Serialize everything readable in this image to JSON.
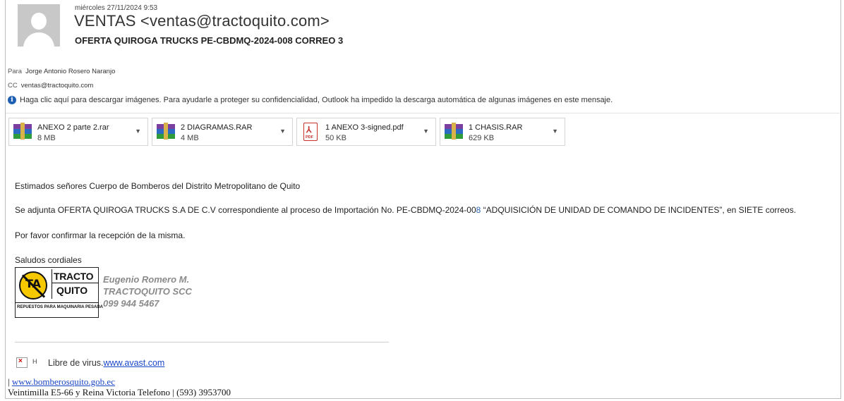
{
  "header": {
    "date": "miércoles 27/11/2024 9:53",
    "sender": "VENTAS <ventas@tractoquito.com>",
    "subject": "OFERTA QUIROGA TRUCKS PE-CBDMQ-2024-008 CORREO 3",
    "to_label": "Para",
    "to_value": "Jorge Antonio Rosero Naranjo",
    "cc_label": "CC",
    "cc_value": "ventas@tractoquito.com",
    "info_icon": "i",
    "info_text": "Haga clic aquí para descargar imágenes. Para ayudarle a proteger su confidencialidad, Outlook ha impedido la descarga automática de algunas imágenes en este mensaje."
  },
  "attachments": [
    {
      "name": "ANEXO 2 parte 2.rar",
      "size": "8 MB",
      "icon": "winrar-archive-icon"
    },
    {
      "name": "2 DIAGRAMAS.RAR",
      "size": "4 MB",
      "icon": "winrar-archive-icon"
    },
    {
      "name": "1 ANEXO 3-signed.pdf",
      "size": "50 KB",
      "icon": "pdf-file-icon"
    },
    {
      "name": "1 CHASIS.RAR",
      "size": "629 KB",
      "icon": "winrar-archive-icon"
    }
  ],
  "body": {
    "greeting": "Estimados señores Cuerpo de Bomberos del Distrito Metropolitano de Quito",
    "line2_a": "Se adjunta OFERTA QUIROGA TRUCKS S.A DE C.V correspondiente al proceso de Importación No.  PE-CBDMQ-2024-00",
    "line2_b": "8",
    "line2_c": "  “ADQUISICIÓN DE UNIDAD DE COMANDO DE INCIDENTES”, en SIETE correos.",
    "confirm": "Por favor confirmar la recepción de la misma.",
    "regards": "Saludos cordiales"
  },
  "signature": {
    "logo_word1": "TRACTO",
    "logo_word2": "QUITO",
    "logo_tagline": "REPUESTOS PARA MAQUINARIA PESADA",
    "logo_mark": "TA",
    "name": "Eugenio Romero M.",
    "company": "TRACTOQUITO SCC",
    "phone": "099 944 5467"
  },
  "footer": {
    "broken_image_alt": "H",
    "virus_text": "Libre de virus.",
    "virus_link": "www.avast.com",
    "web_prefix": "| ",
    "web_link": "www.bomberosquito.gob.ec",
    "address": "Veintimilla E5-66 y Reina Victoria Telefono | (593) 3953700"
  },
  "colors": {
    "info_icon": "#1e5fb4",
    "link": "#1a46c8",
    "pdf_red": "#c8312c",
    "logo_yellow": "#f5c800",
    "signature_gray": "#8a8a8a"
  }
}
